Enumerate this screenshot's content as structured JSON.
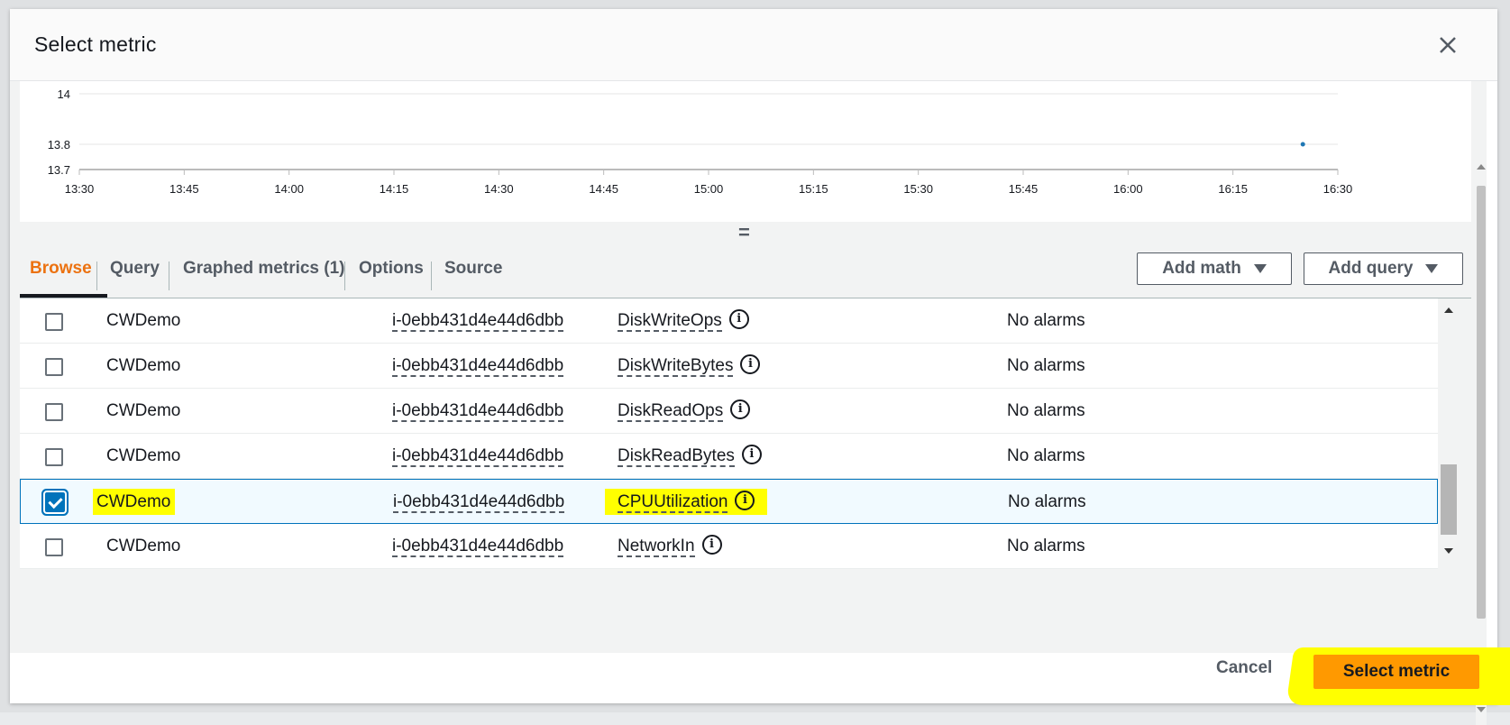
{
  "modal": {
    "title": "Select metric",
    "close_icon": "close-icon"
  },
  "chart_data": {
    "type": "scatter",
    "title": "",
    "xlabel": "",
    "ylabel": "",
    "y_ticks": [
      "14",
      "13.8",
      "13.7"
    ],
    "x_ticks": [
      "13:30",
      "13:45",
      "14:00",
      "14:15",
      "14:30",
      "14:45",
      "15:00",
      "15:15",
      "15:30",
      "15:45",
      "16:00",
      "16:15",
      "16:30"
    ],
    "ylim": [
      13.7,
      14
    ],
    "xlim": [
      "13:30",
      "16:30"
    ],
    "series": [
      {
        "x": [
          "16:25"
        ],
        "y": [
          13.8
        ],
        "color": "#1f77b4"
      }
    ],
    "grid": true
  },
  "tabs": [
    {
      "label": "Browse",
      "active": true
    },
    {
      "label": "Query",
      "active": false
    },
    {
      "label": "Graphed metrics (1)",
      "active": false
    },
    {
      "label": "Options",
      "active": false
    },
    {
      "label": "Source",
      "active": false
    }
  ],
  "actions": {
    "add_math": "Add math",
    "add_query": "Add query"
  },
  "rows": [
    {
      "namespace": "CWDemo",
      "instance": "i-0ebb431d4e44d6dbb",
      "metric": "DiskWriteOps",
      "alarms": "No alarms",
      "checked": false
    },
    {
      "namespace": "CWDemo",
      "instance": "i-0ebb431d4e44d6dbb",
      "metric": "DiskWriteBytes",
      "alarms": "No alarms",
      "checked": false
    },
    {
      "namespace": "CWDemo",
      "instance": "i-0ebb431d4e44d6dbb",
      "metric": "DiskReadOps",
      "alarms": "No alarms",
      "checked": false
    },
    {
      "namespace": "CWDemo",
      "instance": "i-0ebb431d4e44d6dbb",
      "metric": "DiskReadBytes",
      "alarms": "No alarms",
      "checked": false
    },
    {
      "namespace": "CWDemo",
      "instance": "i-0ebb431d4e44d6dbb",
      "metric": "CPUUtilization",
      "alarms": "No alarms",
      "checked": true
    },
    {
      "namespace": "CWDemo",
      "instance": "i-0ebb431d4e44d6dbb",
      "metric": "NetworkIn",
      "alarms": "No alarms",
      "checked": false
    }
  ],
  "footer": {
    "cancel_label": "Cancel",
    "select_label": "Select metric"
  },
  "colors": {
    "accent": "#ec7211",
    "primary_button": "#ff9900",
    "selection_border": "#0073bb",
    "highlight": "#ffff00"
  }
}
